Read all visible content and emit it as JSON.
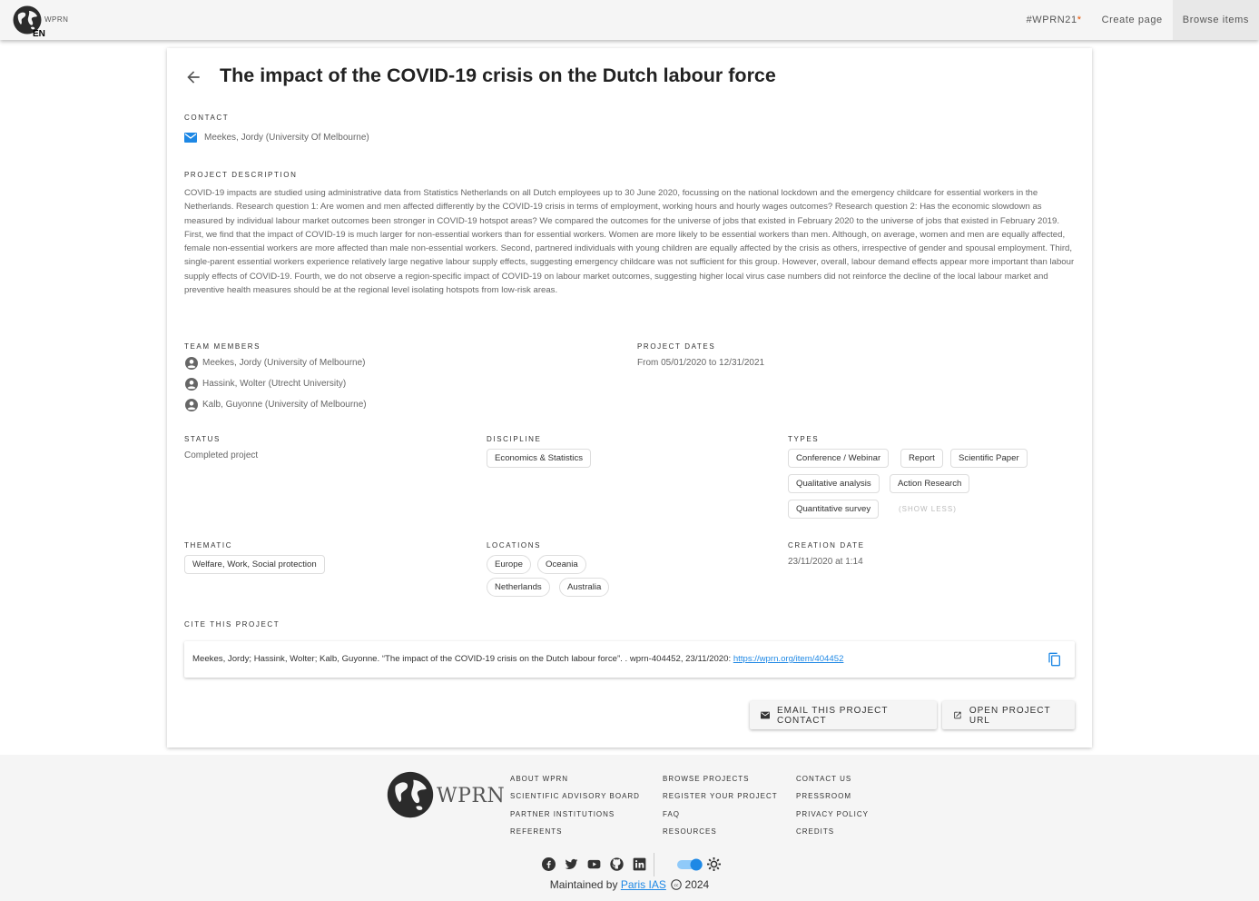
{
  "header": {
    "logo_text": "WPRN",
    "language": "EN",
    "nav": [
      {
        "label": "#WPRN21",
        "star": "*"
      },
      {
        "label": "Create page"
      },
      {
        "label": "Browse items"
      }
    ]
  },
  "project": {
    "title": "The impact of the COVID-19 crisis on the Dutch labour force",
    "contact_label": "CONTACT",
    "contact_name": "Meekes, Jordy (University Of Melbourne)",
    "description_label": "PROJECT DESCRIPTION",
    "description": "COVID-19 impacts are studied using administrative data from Statistics Netherlands on all Dutch employees up to 30 June 2020, focussing on the national lockdown and the emergency childcare for essential workers in the Netherlands. Research question 1: Are women and men affected differently by the COVID-19 crisis in terms of employment, working hours and hourly wages outcomes? Research question 2: Has the economic slowdown as measured by individual labour market outcomes been stronger in COVID-19 hotspot areas? We compared the outcomes for the universe of jobs that existed in February 2020 to the universe of jobs that existed in February 2019. First, we find that the impact of COVID-19 is much larger for non-essential workers than for essential workers. Women are more likely to be essential workers than men. Although, on average, women and men are equally affected, female non-essential workers are more affected than male non-essential workers. Second, partnered individuals with young children are equally affected by the crisis as others, irrespective of gender and spousal employment. Third, single-parent essential workers experience relatively large negative labour supply effects, suggesting emergency childcare was not sufficient for this group. However, overall, labour demand effects appear more important than labour supply effects of COVID-19. Fourth, we do not observe a region-specific impact of COVID-19 on labour market outcomes, suggesting higher local virus case numbers did not reinforce the decline of the local labour market and preventive health measures should be at the regional level isolating hotspots from low-risk areas.",
    "team_label": "TEAM MEMBERS",
    "team": [
      "Meekes, Jordy (University of Melbourne)",
      "Hassink, Wolter (Utrecht University)",
      "Kalb, Guyonne (University of Melbourne)"
    ],
    "dates_label": "PROJECT DATES",
    "dates": "From 05/01/2020 to 12/31/2021",
    "status_label": "STATUS",
    "status": "Completed project",
    "discipline_label": "DISCIPLINE",
    "disciplines": [
      "Economics & Statistics"
    ],
    "types_label": "TYPES",
    "types": [
      "Conference / Webinar",
      "Report",
      "Scientific Paper",
      "Qualitative analysis",
      "Action Research",
      "Quantitative survey"
    ],
    "show_less": "(SHOW LESS)",
    "thematic_label": "THEMATIC",
    "thematics": [
      "Welfare, Work, Social protection"
    ],
    "locations_label": "LOCATIONS",
    "locations": [
      "Europe",
      "Oceania",
      "Netherlands",
      "Australia"
    ],
    "creation_label": "CREATION DATE",
    "creation_date": "23/11/2020 at 1:14",
    "cite_label": "CITE THIS PROJECT",
    "cite_prefix": "Meekes, Jordy; Hassink, Wolter; Kalb, Guyonne. “The impact of the COVID-19 crisis on the Dutch labour force”. . wprn-404452, 23/11/2020: ",
    "cite_link": "https://wprn.org/item/404452",
    "email_button": "EMAIL THIS PROJECT CONTACT",
    "open_button": "OPEN PROJECT URL"
  },
  "footer": {
    "logo_text": "WPRN",
    "col1": [
      "ABOUT WPRN",
      "SCIENTIFIC ADVISORY BOARD",
      "PARTNER INSTITUTIONS",
      "REFERENTS"
    ],
    "col2": [
      "BROWSE PROJECTS",
      "REGISTER YOUR PROJECT",
      "FAQ",
      "RESOURCES"
    ],
    "col3": [
      "CONTACT US",
      "PRESSROOM",
      "PRIVACY POLICY",
      "CREDITS"
    ],
    "maintained_prefix": "Maintained by ",
    "maintained_link": "Paris IAS",
    "year": "2024",
    "social_icons": [
      "facebook-icon",
      "twitter-icon",
      "youtube-icon",
      "github-icon",
      "linkedin-icon"
    ],
    "theme_toggle_on": true
  },
  "colors": {
    "accent": "#1e88e5",
    "star": "#e65100",
    "footer_bg": "#f5f5f5"
  }
}
